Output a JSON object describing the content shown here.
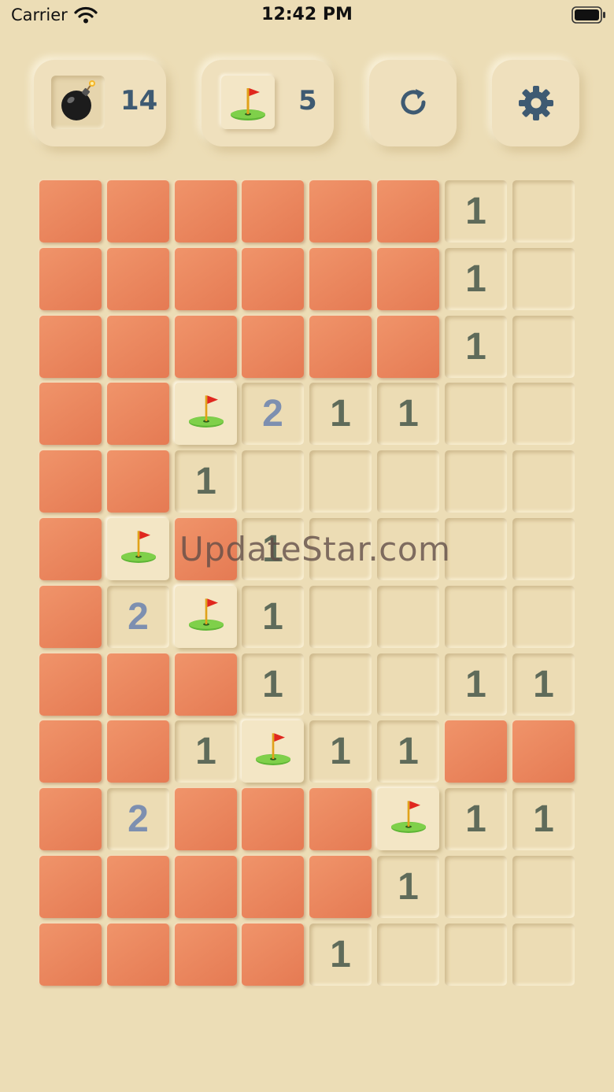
{
  "status_bar": {
    "carrier": "Carrier",
    "time": "12:42 PM"
  },
  "counters": {
    "mines": {
      "icon": "bomb-icon",
      "value": "14"
    },
    "flags": {
      "icon": "flag-icon",
      "value": "5"
    }
  },
  "actions": {
    "restart_icon": "restart-icon",
    "settings_icon": "gear-icon"
  },
  "colors": {
    "background": "#ecddb6",
    "covered": "#e9825a",
    "number_one": "#5f6b5a",
    "number_two": "#7d8fb0",
    "counter_text": "#3e5a72"
  },
  "board": {
    "rows": 12,
    "cols": 8,
    "legend": {
      "C": "covered",
      "F": "flag",
      "0": "open-empty",
      "1-8": "open-number"
    },
    "cells": [
      [
        "C",
        "C",
        "C",
        "C",
        "C",
        "C",
        "1",
        "0"
      ],
      [
        "C",
        "C",
        "C",
        "C",
        "C",
        "C",
        "1",
        "0"
      ],
      [
        "C",
        "C",
        "C",
        "C",
        "C",
        "C",
        "1",
        "0"
      ],
      [
        "C",
        "C",
        "F",
        "2",
        "1",
        "1",
        "0",
        "0"
      ],
      [
        "C",
        "C",
        "1",
        "0",
        "0",
        "0",
        "0",
        "0"
      ],
      [
        "C",
        "F",
        "C",
        "1",
        "0",
        "0",
        "0",
        "0"
      ],
      [
        "C",
        "2",
        "F",
        "1",
        "0",
        "0",
        "0",
        "0"
      ],
      [
        "C",
        "C",
        "C",
        "1",
        "0",
        "0",
        "1",
        "1"
      ],
      [
        "C",
        "C",
        "1",
        "F",
        "1",
        "1",
        "C",
        "C"
      ],
      [
        "C",
        "2",
        "C",
        "C",
        "C",
        "F",
        "1",
        "1"
      ],
      [
        "C",
        "C",
        "C",
        "C",
        "C",
        "1",
        "0",
        "0"
      ],
      [
        "C",
        "C",
        "C",
        "C",
        "1",
        "0",
        "0",
        "0"
      ]
    ]
  },
  "watermark": "UpdateStar.com"
}
